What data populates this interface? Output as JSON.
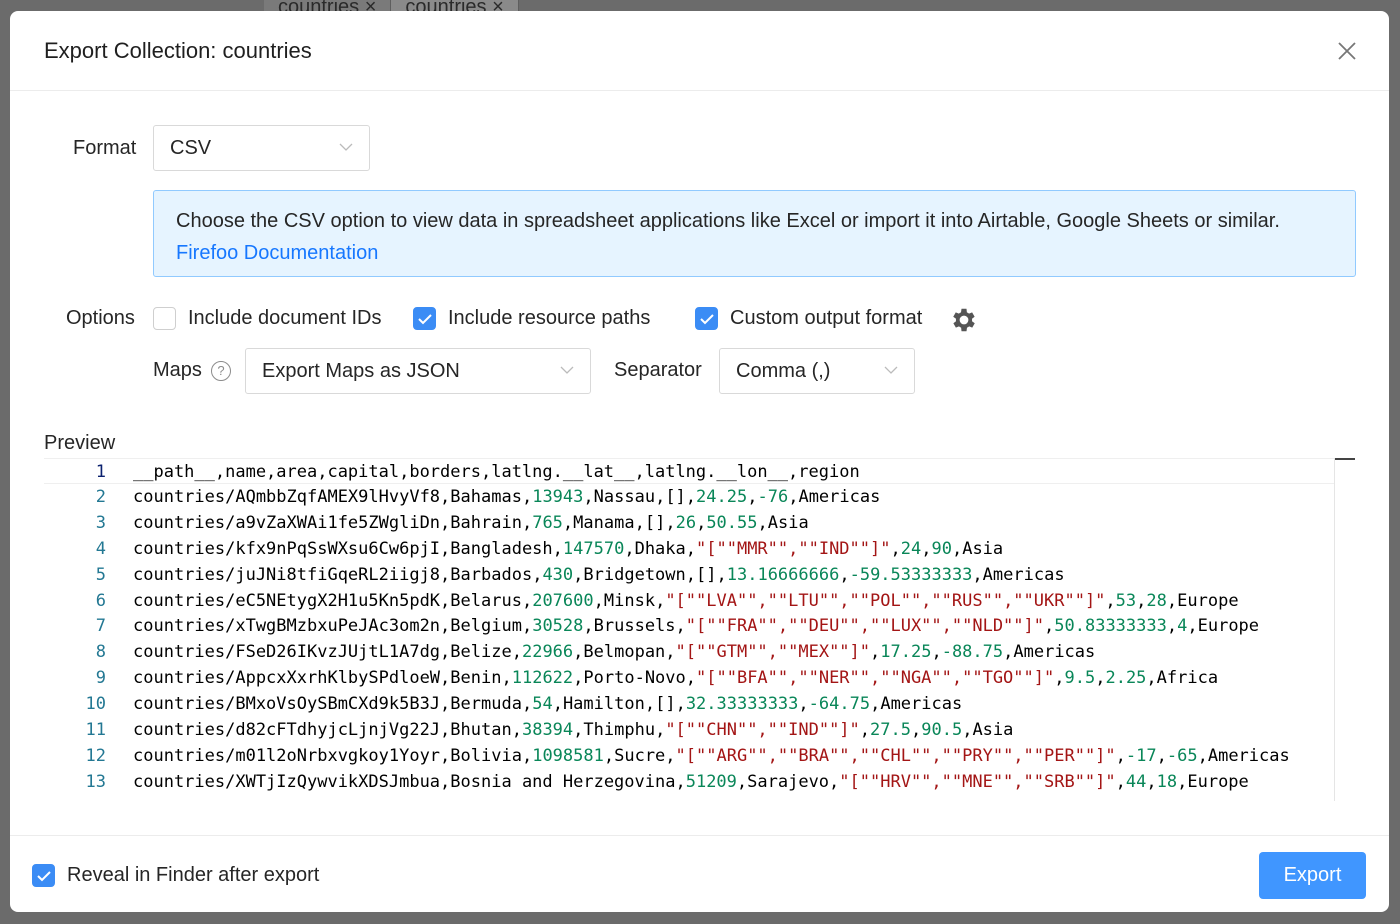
{
  "background": {
    "tabs": [
      "countries ×",
      "countries ×"
    ]
  },
  "dialog": {
    "title": "Export Collection: countries",
    "format": {
      "label": "Format",
      "value": "CSV"
    },
    "info": {
      "text": "Choose the CSV option to view data in spreadsheet applications like Excel or import it into Airtable, Google Sheets or similar. ",
      "link": "Firefoo Documentation"
    },
    "options": {
      "label": "Options",
      "include_ids": {
        "label": "Include document IDs",
        "checked": false
      },
      "include_paths": {
        "label": "Include resource paths",
        "checked": true
      },
      "custom_format": {
        "label": "Custom output format",
        "checked": true
      }
    },
    "maps": {
      "label": "Maps",
      "value": "Export Maps as JSON",
      "help_icon": "question-circle-icon"
    },
    "separator": {
      "label": "Separator",
      "value": "Comma (,)"
    },
    "preview": {
      "label": "Preview",
      "lines": [
        "__path__,name,area,capital,borders,latlng.__lat__,latlng.__lon__,region",
        "countries/AQmbbZqfAMEX9lHvyVf8,Bahamas,13943,Nassau,[],24.25,-76,Americas",
        "countries/a9vZaXWAi1fe5ZWgliDn,Bahrain,765,Manama,[],26,50.55,Asia",
        "countries/kfx9nPqSsWXsu6Cw6pjI,Bangladesh,147570,Dhaka,\"[\"\"MMR\"\",\"\"IND\"\"]\",24,90,Asia",
        "countries/juJNi8tfiGqeRL2iigj8,Barbados,430,Bridgetown,[],13.16666666,-59.53333333,Americas",
        "countries/eC5NEtygX2H1u5Kn5pdK,Belarus,207600,Minsk,\"[\"\"LVA\"\",\"\"LTU\"\",\"\"POL\"\",\"\"RUS\"\",\"\"UKR\"\"]\",53,28,Europe",
        "countries/xTwgBMzbxuPeJAc3om2n,Belgium,30528,Brussels,\"[\"\"FRA\"\",\"\"DEU\"\",\"\"LUX\"\",\"\"NLD\"\"]\",50.83333333,4,Europe",
        "countries/FSeD26IKvzJUjtL1A7dg,Belize,22966,Belmopan,\"[\"\"GTM\"\",\"\"MEX\"\"]\",17.25,-88.75,Americas",
        "countries/AppcxXxrhKlbySPdloeW,Benin,112622,Porto-Novo,\"[\"\"BFA\"\",\"\"NER\"\",\"\"NGA\"\",\"\"TGO\"\"]\",9.5,2.25,Africa",
        "countries/BMxoVsOySBmCXd9k5B3J,Bermuda,54,Hamilton,[],32.33333333,-64.75,Americas",
        "countries/d82cFTdhyjcLjnjVg22J,Bhutan,38394,Thimphu,\"[\"\"CHN\"\",\"\"IND\"\"]\",27.5,90.5,Asia",
        "countries/m01l2oNrbxvgkoy1Yoyr,Bolivia,1098581,Sucre,\"[\"\"ARG\"\",\"\"BRA\"\",\"\"CHL\"\",\"\"PRY\"\",\"\"PER\"\"]\",-17,-65,Americas",
        "countries/XWTjIzQywvikXDSJmbua,Bosnia and Herzegovina,51209,Sarajevo,\"[\"\"HRV\"\",\"\"MNE\"\",\"\"SRB\"\"]\",44,18,Europe"
      ]
    },
    "footer": {
      "reveal": {
        "label": "Reveal in Finder after export",
        "checked": true
      },
      "export_label": "Export"
    },
    "colors": {
      "accent": "#4096ff",
      "number": "#098658",
      "string": "#a31515",
      "info_bg": "#e6f4ff"
    }
  }
}
